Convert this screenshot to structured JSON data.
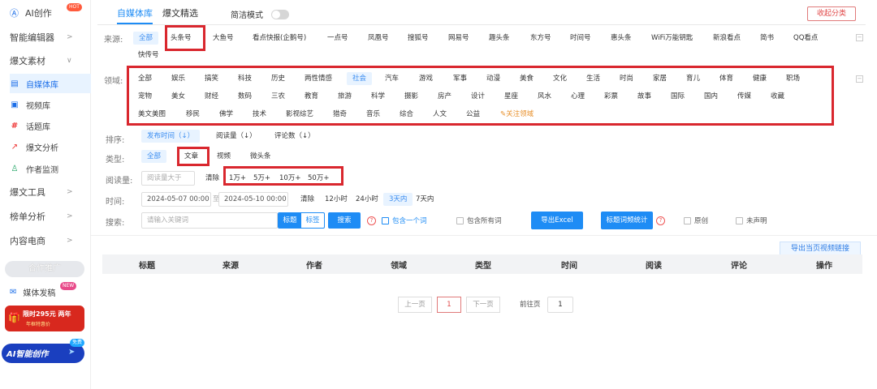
{
  "sidebar": {
    "ai_create": "AI创作",
    "ai_create_badge": "HOT",
    "smart_editor": "智能编辑器",
    "material": "爆文素材",
    "material_items": [
      {
        "label": "自媒体库",
        "icon": "document-icon"
      },
      {
        "label": "视频库",
        "icon": "video-icon"
      },
      {
        "label": "话题库",
        "icon": "hash-icon"
      },
      {
        "label": "爆文分析",
        "icon": "chart-icon"
      },
      {
        "label": "作者监测",
        "icon": "user-add-icon"
      }
    ],
    "tools": "爆文工具",
    "rank": "榜单分析",
    "ecommerce": "内容电商",
    "promo_divider": "合作推广",
    "media_publish": "媒体发稿",
    "new_badge": "NEW",
    "banner1_text": "限时295元 两年",
    "banner1_sub": "年框特惠价",
    "banner2_text": "AI智能创作",
    "banner2_badge": "免费"
  },
  "tabs": {
    "tab1": "自媒体库",
    "tab2": "爆文精选",
    "simple_mode": "简洁模式",
    "collapse": "收起分类"
  },
  "source": {
    "label": "来源:",
    "items": [
      "全部",
      "头条号",
      "大鱼号",
      "看点快报(企鹅号)",
      "一点号",
      "凤凰号",
      "搜狐号",
      "网易号",
      "趣头条",
      "东方号",
      "时间号",
      "惠头条",
      "WiFi万能钥匙",
      "新浪看点",
      "简书",
      "QQ看点",
      "快传号"
    ],
    "selected": "全部"
  },
  "domain": {
    "label": "领域:",
    "row1": [
      "全部",
      "娱乐",
      "搞笑",
      "科技",
      "历史",
      "两性情感",
      "社会",
      "汽车",
      "游戏",
      "军事",
      "动漫",
      "美食",
      "文化",
      "生活",
      "时尚",
      "家居",
      "育儿",
      "体育",
      "健康",
      "职场"
    ],
    "row2": [
      "宠物",
      "美女",
      "财经",
      "数码",
      "三农",
      "教育",
      "旅游",
      "科学",
      "摄影",
      "房产",
      "设计",
      "星座",
      "风水",
      "心理",
      "彩票",
      "故事",
      "国际",
      "国内",
      "传媒",
      "收藏"
    ],
    "row3": [
      "美文美图",
      "移民",
      "佛学",
      "技术",
      "影视综艺",
      "猎奇",
      "音乐",
      "综合",
      "人文",
      "公益"
    ],
    "follow": "关注领域",
    "selected": "社会"
  },
  "sort": {
    "label": "排序:",
    "items": [
      "发布时间（↓）",
      "阅读量（↓）",
      "评论数（↓）"
    ]
  },
  "type": {
    "label": "类型:",
    "items": [
      "全部",
      "文章",
      "视频",
      "微头条"
    ]
  },
  "reads": {
    "label": "阅读量:",
    "placeholder": "阅读量大于",
    "clear": "清除",
    "options": [
      "1万+",
      "5万+",
      "10万+",
      "50万+"
    ]
  },
  "time": {
    "label": "时间:",
    "start": "2024-05-07 00:00",
    "to": "至",
    "end": "2024-05-10 00:00",
    "clear": "清除",
    "options": [
      "12小时",
      "24小时",
      "3天内",
      "7天内"
    ],
    "selected": "3天内"
  },
  "search": {
    "label": "搜索:",
    "placeholder": "请输入关键词",
    "mode_title": "标题",
    "mode_tag": "标签",
    "button": "搜索",
    "contains_one": "包含一个词",
    "contains_all": "包含所有词",
    "export_excel": "导出Excel",
    "word_stats": "标题词频统计",
    "original": "原创",
    "unclaimed": "未声明"
  },
  "export_video": "导出当页视频链接",
  "table": {
    "headers": [
      "标题",
      "来源",
      "作者",
      "领域",
      "类型",
      "时间",
      "阅读",
      "评论",
      "操作"
    ]
  },
  "pagination": {
    "prev": "上一页",
    "current": "1",
    "next": "下一页",
    "goto": "前往页",
    "goto_value": "1"
  },
  "colors": {
    "accent": "#1e8cf5",
    "highlight_box": "#d9272e"
  }
}
